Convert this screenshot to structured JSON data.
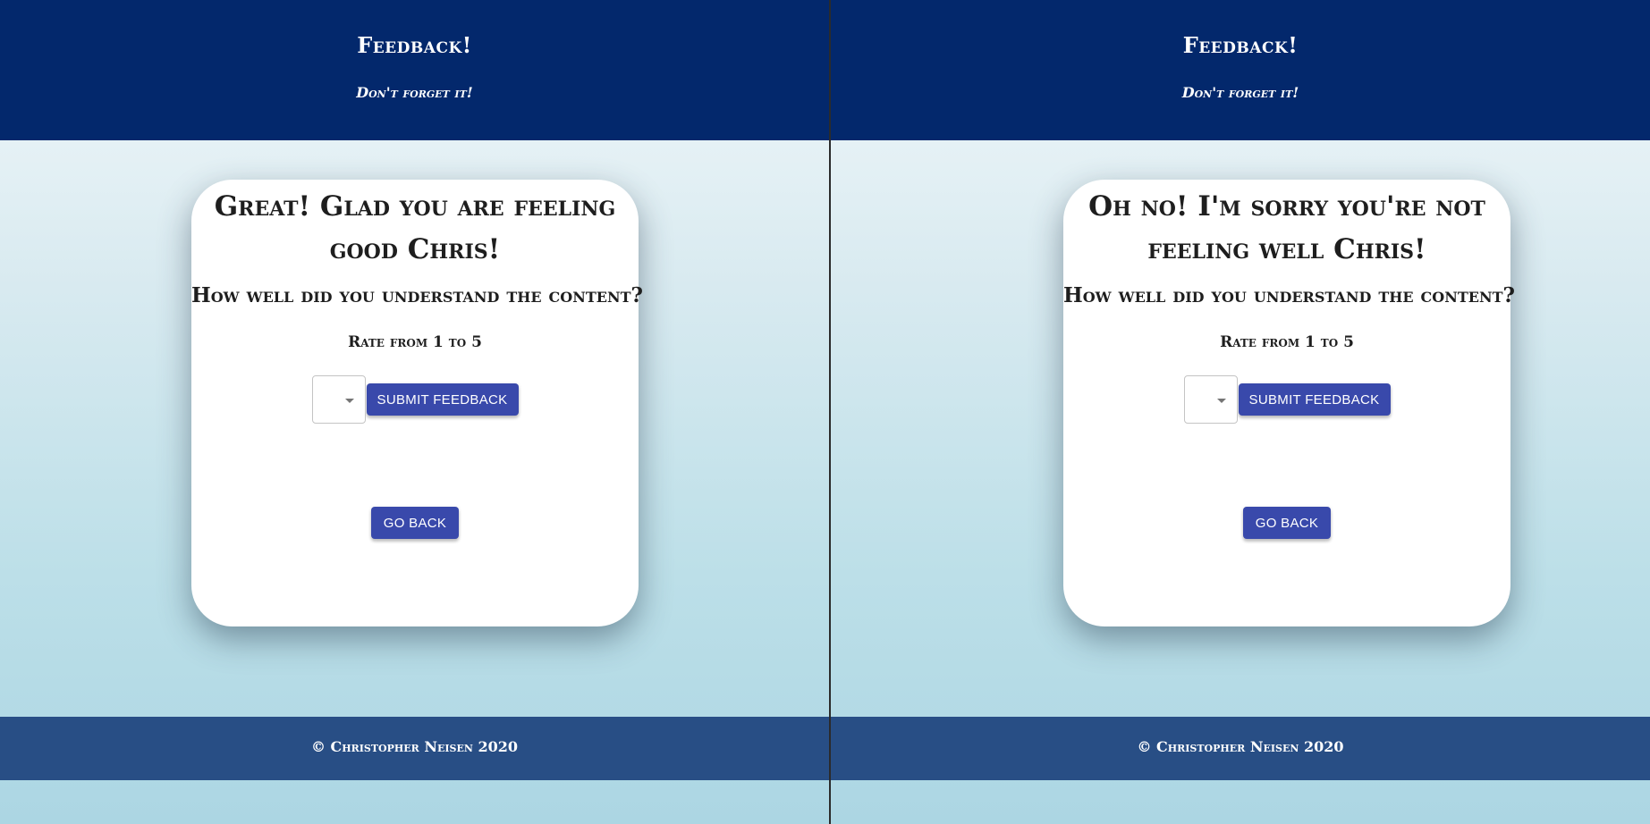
{
  "colors": {
    "header_bg": "#03286c",
    "footer_bg": "#284e85",
    "button_bg": "#3949ab",
    "card_bg": "#ffffff"
  },
  "panels": [
    {
      "header": {
        "title": "Feedback!",
        "tagline": "Don't forget it!"
      },
      "card": {
        "heading": "Great! Glad you are feeling good Chris!",
        "question": "How well did you understand the content?",
        "rate_hint": "Rate from 1 to 5",
        "rating_value": "",
        "submit_label": "SUBMIT FEEDBACK",
        "back_label": "GO BACK"
      },
      "footer": {
        "text": "© Christopher Neisen 2020"
      }
    },
    {
      "header": {
        "title": "Feedback!",
        "tagline": "Don't forget it!"
      },
      "card": {
        "heading": "Oh no! I'm sorry you're not feeling well Chris!",
        "question": "How well did you understand the content?",
        "rate_hint": "Rate from 1 to 5",
        "rating_value": "",
        "submit_label": "SUBMIT FEEDBACK",
        "back_label": "GO BACK"
      },
      "footer": {
        "text": "© Christopher Neisen 2020"
      }
    }
  ]
}
